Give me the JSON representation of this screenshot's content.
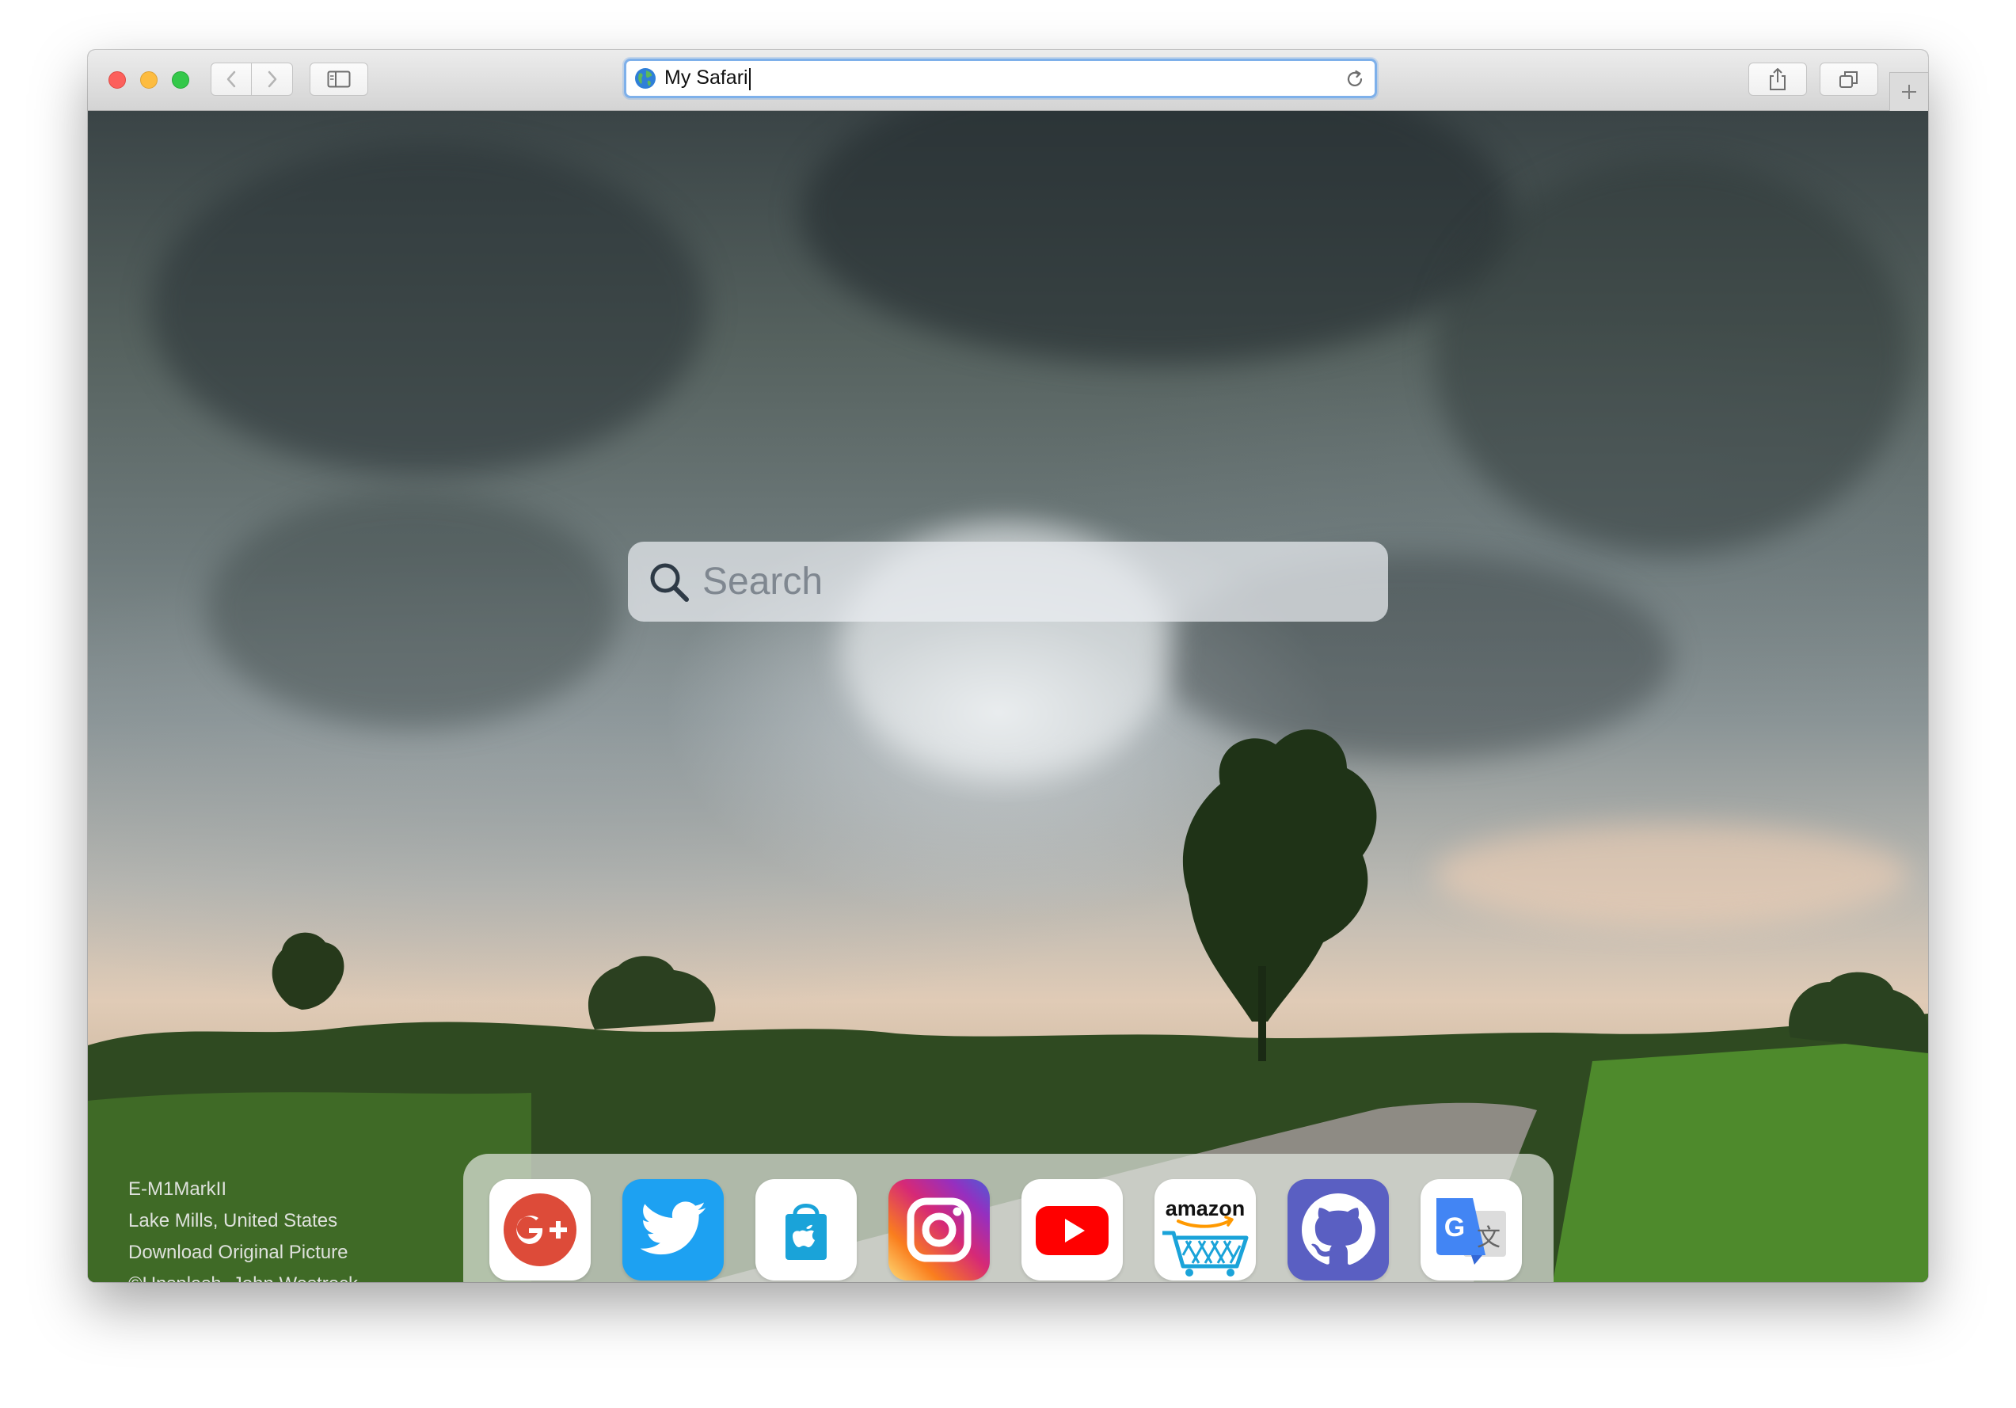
{
  "browser": {
    "address_text": "My Safari"
  },
  "search": {
    "placeholder": "Search"
  },
  "photo": {
    "camera": "E-M1MarkII",
    "location": "Lake Mills, United States",
    "download_label": "Download Original Picture",
    "credit_source": "©Unsplash",
    "credit_author": "John Westrock"
  },
  "dock": {
    "apps": [
      {
        "name": "Google+",
        "icon": "google-plus-icon",
        "color": "#dd4b39"
      },
      {
        "name": "Twitter",
        "icon": "twitter-bird-icon",
        "color": "#1da1f2"
      },
      {
        "name": "App Store",
        "icon": "app-store-bag-icon",
        "color": "#1aa3d9"
      },
      {
        "name": "Instagram",
        "icon": "instagram-camera-icon",
        "color": "#c13584"
      },
      {
        "name": "YouTube",
        "icon": "youtube-play-icon",
        "color": "#ff0000"
      },
      {
        "name": "Amazon",
        "icon": "amazon-cart-icon",
        "color": "#1aa3d9",
        "label": "amazon"
      },
      {
        "name": "GitHub",
        "icon": "github-octocat-icon",
        "color": "#5a5fc2"
      },
      {
        "name": "Google Translate",
        "icon": "google-translate-icon",
        "color": "#4285f4"
      }
    ]
  },
  "colors": {
    "address_focus": "#7eb0ea",
    "close": "#fc605c",
    "minimize": "#fdbc40",
    "maximize": "#34c84a"
  }
}
